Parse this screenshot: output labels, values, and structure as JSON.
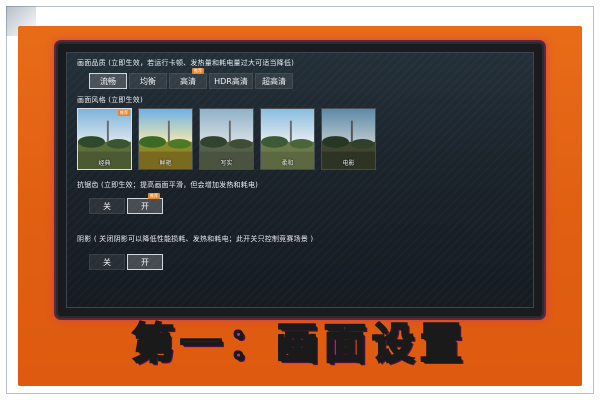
{
  "quality": {
    "title": "画面品质 (立即生效，若运行卡顿、发热量和耗电量过大可适当降低)",
    "options": [
      "流畅",
      "均衡",
      "高清",
      "HDR高清",
      "超高清"
    ],
    "selected": "流畅",
    "badge": "推荐"
  },
  "style": {
    "title": "画面风格 (立即生效)",
    "options": [
      "经典",
      "鲜艳",
      "写实",
      "柔和",
      "电影"
    ],
    "selected": "经典",
    "badge": "推荐"
  },
  "antialias": {
    "title": "抗锯齿 (立即生效；提高画面平滑，但会增加发热和耗电)",
    "off": "关",
    "on": "开",
    "selected": "开",
    "badge": "推荐"
  },
  "shadow": {
    "title": "阴影 ( 关闭阴影可以降低性能损耗、发热和耗电；此开关只控制竞赛场景 )",
    "off": "关",
    "on": "开",
    "selected": "开"
  },
  "caption": "第一：画面设置",
  "colors": {
    "board": "#e86c18",
    "caption_fill": "#c4219e",
    "glow": "#d22878",
    "badge": "#e8862a"
  }
}
